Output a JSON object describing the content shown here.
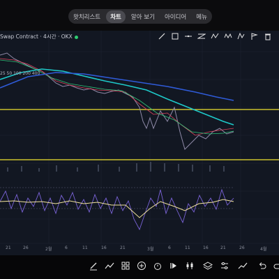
{
  "tabs": [
    "왓치리스트",
    "차트",
    "알아 보기",
    "아이디어",
    "메뉴"
  ],
  "chart_title": "Swap Contract · 4시간 · OKX",
  "ma_label": "25 50 100 200 400",
  "x_labels": [
    "21",
    "26",
    "2월",
    "6",
    "11",
    "16",
    "21",
    "3월",
    "6",
    "11",
    "16",
    "21",
    "26",
    "4월"
  ],
  "drawing_tools": [
    "line-tool-icon",
    "rectangle-tool-icon",
    "horizontal-line-icon",
    "pattern-tool-icon",
    "wave-tool-icon",
    "zigzag-tool-icon",
    "xabcd-tool-icon",
    "flag-tool-icon",
    "delete-tool-icon"
  ],
  "bottom_toolbar": [
    "pencil-icon",
    "indicator-icon",
    "grid-icon",
    "add-icon",
    "alarm-icon",
    "replay-icon",
    "layers-icon",
    "settings-icon",
    "trend-icon",
    "undo-icon",
    "redo-icon"
  ],
  "colors": {
    "horizontal_line": "#f0e130",
    "ma_blue": "#2f5bd8",
    "ma_teal": "#1ec9c9",
    "rsi": "#7a63d8",
    "rsi_smooth": "#f2e39c"
  }
}
